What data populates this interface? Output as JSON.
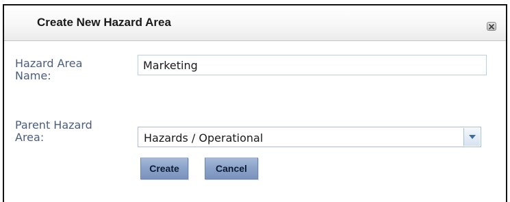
{
  "dialog": {
    "title": "Create New Hazard Area",
    "close_icon": "close-icon"
  },
  "form": {
    "name_label_line1": "Hazard Area",
    "name_label_line2": "Name:",
    "name_value": "Marketing",
    "parent_label_line1": "Parent Hazard",
    "parent_label_line2": "Area:",
    "parent_value": "Hazards / Operational",
    "dropdown_icon": "chevron-down-icon"
  },
  "buttons": {
    "create_label": "Create",
    "cancel_label": "Cancel"
  },
  "colors": {
    "label_text": "#4a5d7e",
    "button_fill": "#8aa2c8",
    "input_border": "#b9cde4"
  }
}
